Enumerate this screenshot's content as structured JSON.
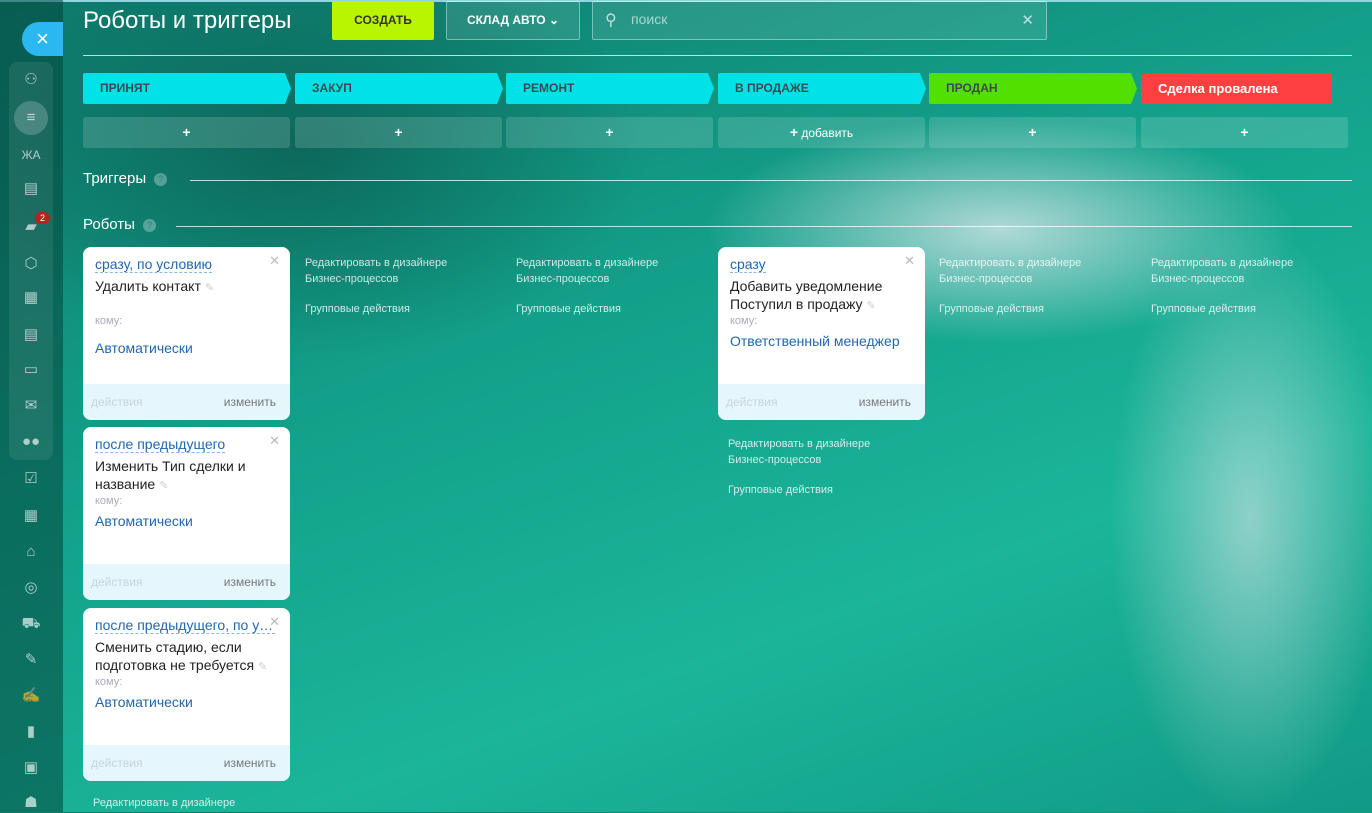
{
  "header": {
    "title": "Роботы и триггеры",
    "create_label": "СОЗДАТЬ",
    "category_label": "СКЛАД АВТО",
    "search_placeholder": "поиск"
  },
  "sidebar": {
    "close": "×",
    "items": [
      {
        "icon": "activity-icon",
        "glyph": "⚇"
      },
      {
        "icon": "filter-icon",
        "glyph": "≡"
      },
      {
        "icon": "text-icon",
        "glyph": "ЖА"
      },
      {
        "icon": "window-icon",
        "glyph": "▤"
      },
      {
        "icon": "chat-icon",
        "glyph": "▰"
      },
      {
        "icon": "hexagon-icon",
        "glyph": "⬡"
      },
      {
        "icon": "calendar-icon",
        "glyph": "▦"
      },
      {
        "icon": "document-icon",
        "glyph": "▤"
      },
      {
        "icon": "drive-icon",
        "glyph": "▭"
      },
      {
        "icon": "mail-icon",
        "glyph": "✉"
      },
      {
        "icon": "group-icon",
        "glyph": "●●"
      },
      {
        "icon": "tasks-icon",
        "glyph": "☑"
      },
      {
        "icon": "schedule-icon",
        "glyph": "▦"
      },
      {
        "icon": "house-icon",
        "glyph": "⌂"
      },
      {
        "icon": "target-icon",
        "glyph": "◎"
      },
      {
        "icon": "cart-icon",
        "glyph": "⛟"
      },
      {
        "icon": "edit-doc-icon",
        "glyph": "✎"
      },
      {
        "icon": "signature-icon",
        "glyph": "✍"
      },
      {
        "icon": "chart-icon",
        "glyph": "▮"
      },
      {
        "icon": "contact-card-icon",
        "glyph": "▣"
      },
      {
        "icon": "robot-icon",
        "glyph": "☗"
      }
    ],
    "chat_badge": "2"
  },
  "stages": [
    {
      "label": "ПРИНЯТ",
      "color": "#00e2e6"
    },
    {
      "label": "ЗАКУП",
      "color": "#00e2e6"
    },
    {
      "label": "РЕМОНТ",
      "color": "#00e2e6"
    },
    {
      "label": "В ПРОДАЖЕ",
      "color": "#00e2e6"
    },
    {
      "label": "ПРОДАН",
      "color": "#52e000"
    },
    {
      "label": "Сделка провалена",
      "color": "#ff4040"
    }
  ],
  "add_label": "добавить",
  "triggers_label": "Триггеры",
  "robots_label": "Роботы",
  "cards": [
    {
      "condition": "сразу, по условию",
      "name": "Удалить контакт",
      "to_label": "кому:",
      "to": "Автоматически",
      "actions": "действия",
      "edit": "изменить"
    },
    {
      "condition": "после предыдущего",
      "name": "Изменить Тип сделки и название",
      "to_label": "кому:",
      "to": "Автоматически",
      "actions": "действия",
      "edit": "изменить"
    },
    {
      "condition": "после предыдущего, по условию",
      "name": "Сменить стадию, если подготовка не требуется",
      "to_label": "кому:",
      "to": "Автоматически",
      "actions": "действия",
      "edit": "изменить"
    },
    {
      "condition": "сразу",
      "name": "Добавить уведомление Поступил в продажу",
      "to_label": "кому:",
      "to": "Ответственный менеджер",
      "actions": "действия",
      "edit": "изменить"
    }
  ],
  "links": {
    "designer": "Редактировать в дизайнере Бизнес-процессов",
    "designer_short": "Редактировать в дизайнере",
    "group": "Групповые действия"
  }
}
